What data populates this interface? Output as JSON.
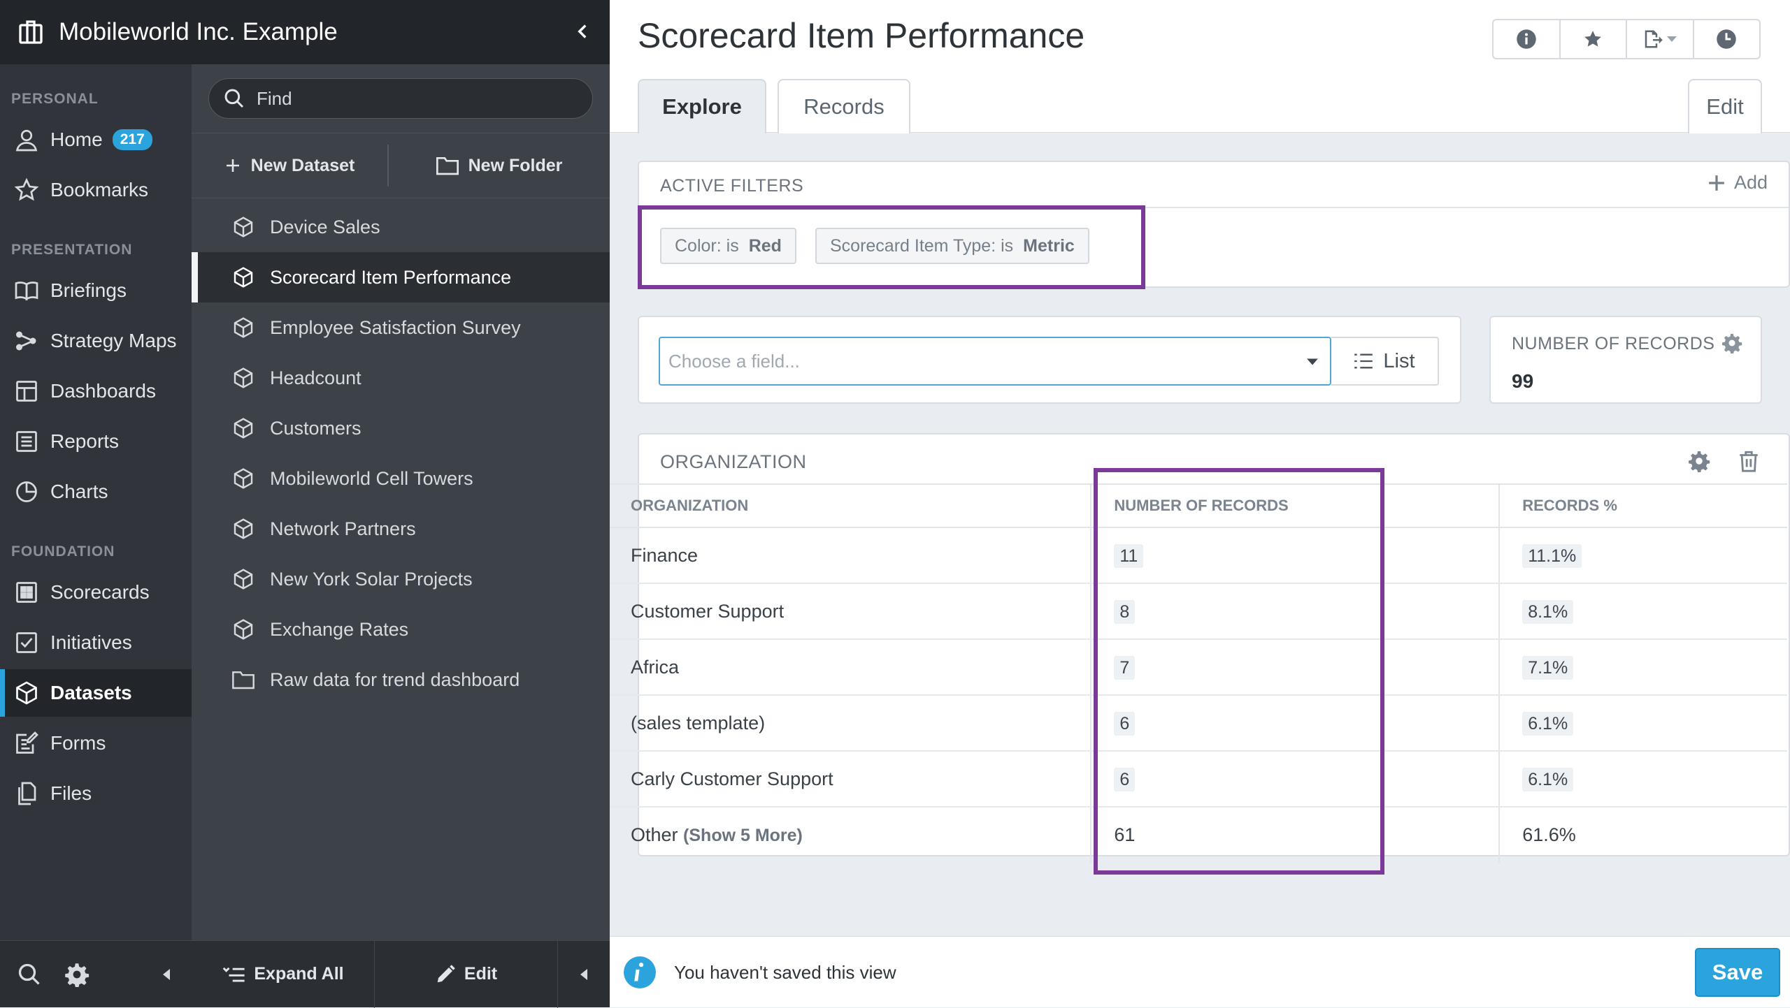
{
  "org": {
    "name": "Mobileworld Inc. Example"
  },
  "nav": {
    "sections": {
      "personal": "PERSONAL",
      "presentation": "PRESENTATION",
      "foundation": "FOUNDATION"
    },
    "items": [
      {
        "label": "Home",
        "icon": "user-icon",
        "badge": "217"
      },
      {
        "label": "Bookmarks",
        "icon": "star-icon"
      },
      {
        "label": "Briefings",
        "icon": "book-icon"
      },
      {
        "label": "Strategy Maps",
        "icon": "strategy-map-icon"
      },
      {
        "label": "Dashboards",
        "icon": "dashboard-icon"
      },
      {
        "label": "Reports",
        "icon": "report-icon"
      },
      {
        "label": "Charts",
        "icon": "pie-chart-icon"
      },
      {
        "label": "Scorecards",
        "icon": "scorecard-icon"
      },
      {
        "label": "Initiatives",
        "icon": "checkbox-icon"
      },
      {
        "label": "Datasets",
        "icon": "cube-icon",
        "active": true
      },
      {
        "label": "Forms",
        "icon": "form-icon"
      },
      {
        "label": "Files",
        "icon": "files-icon"
      }
    ]
  },
  "panel": {
    "search_placeholder": "Find",
    "new_dataset": "New Dataset",
    "new_folder": "New Folder",
    "items": [
      {
        "label": "Device Sales",
        "type": "dataset"
      },
      {
        "label": "Scorecard Item Performance",
        "type": "dataset",
        "active": true
      },
      {
        "label": "Employee Satisfaction Survey",
        "type": "dataset"
      },
      {
        "label": "Headcount",
        "type": "dataset"
      },
      {
        "label": "Customers",
        "type": "dataset"
      },
      {
        "label": "Mobileworld Cell Towers",
        "type": "dataset"
      },
      {
        "label": "Network Partners",
        "type": "dataset"
      },
      {
        "label": "New York Solar Projects",
        "type": "dataset"
      },
      {
        "label": "Exchange Rates",
        "type": "dataset"
      },
      {
        "label": "Raw data for trend dashboard",
        "type": "folder"
      }
    ],
    "expand_all": "Expand All",
    "edit": "Edit"
  },
  "main": {
    "title": "Scorecard Item Performance",
    "tabs": {
      "explore": "Explore",
      "records": "Records",
      "edit": "Edit"
    },
    "filters": {
      "title": "ACTIVE FILTERS",
      "add": "Add",
      "chips": [
        {
          "field": "Color:",
          "op": "is",
          "value": "Red"
        },
        {
          "field": "Scorecard Item Type:",
          "op": "is",
          "value": "Metric"
        }
      ]
    },
    "field_select": {
      "placeholder": "Choose a field...",
      "list_label": "List"
    },
    "record_count": {
      "title": "NUMBER OF RECORDS",
      "value": "99"
    },
    "group": {
      "title": "ORGANIZATION",
      "columns": [
        "ORGANIZATION",
        "NUMBER OF RECORDS",
        "RECORDS %"
      ],
      "rows": [
        {
          "name": "Finance",
          "count": "11",
          "pct": "11.1%"
        },
        {
          "name": "Customer Support",
          "count": "8",
          "pct": "8.1%"
        },
        {
          "name": "Africa",
          "count": "7",
          "pct": "7.1%"
        },
        {
          "name": "(sales template)",
          "count": "6",
          "pct": "6.1%"
        },
        {
          "name": "Carly Customer Support",
          "count": "6",
          "pct": "6.1%"
        }
      ],
      "other": {
        "name": "Other",
        "more": "(Show 5 More)",
        "count": "61",
        "pct": "61.6%"
      }
    },
    "status": {
      "message": "You haven't saved this view",
      "save": "Save"
    }
  },
  "colors": {
    "accent": "#2ba3dd",
    "highlight": "#7b3a98",
    "nav_bg": "#31353b",
    "panel_bg": "#3d4148"
  }
}
